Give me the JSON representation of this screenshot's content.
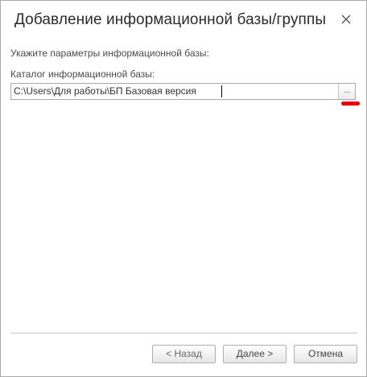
{
  "dialog": {
    "title": "Добавление информационной базы/группы",
    "close_icon": "close-icon"
  },
  "form": {
    "prompt": "Укажите параметры информационной базы:",
    "catalog_label": "Каталог информационной базы:",
    "catalog_value": "C:\\Users\\Для работы\\БП Базовая версия",
    "browse_label": "..."
  },
  "annotation": {
    "color": "#e8000b"
  },
  "buttons": {
    "back_label": "< Назад",
    "next_label": "Далее >",
    "cancel_label": "Отмена"
  }
}
